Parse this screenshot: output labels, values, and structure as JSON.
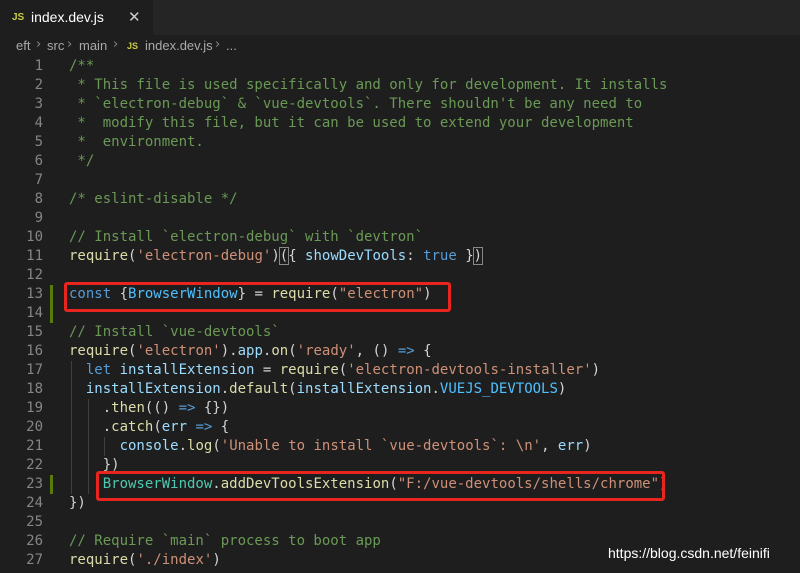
{
  "tab": {
    "badge": "JS",
    "title": "index.dev.js",
    "close_glyph": "✕"
  },
  "breadcrumb": {
    "items": [
      "eft",
      "src",
      "main"
    ],
    "file_badge": "JS",
    "file": "index.dev.js",
    "more": "..."
  },
  "editor": {
    "line_numbers": [
      "1",
      "2",
      "3",
      "4",
      "5",
      "6",
      "7",
      "8",
      "9",
      "10",
      "11",
      "12",
      "13",
      "14",
      "15",
      "16",
      "17",
      "18",
      "19",
      "20",
      "21",
      "22",
      "23",
      "24",
      "25",
      "26",
      "27"
    ],
    "lines": [
      [
        {
          "t": "/**",
          "c": "c"
        }
      ],
      [
        {
          "t": " * This file is used specifically and only for development. It installs",
          "c": "c"
        }
      ],
      [
        {
          "t": " * `electron-debug` & `vue-devtools`. There shouldn't be any need to",
          "c": "c"
        }
      ],
      [
        {
          "t": " *  modify this file, but it can be used to extend your development",
          "c": "c"
        }
      ],
      [
        {
          "t": " *  environment.",
          "c": "c"
        }
      ],
      [
        {
          "t": " */",
          "c": "c"
        }
      ],
      [],
      [
        {
          "t": "/* eslint-disable */",
          "c": "c"
        }
      ],
      [],
      [
        {
          "t": "// Install `electron-debug` with `devtron`",
          "c": "c"
        }
      ],
      [
        {
          "t": "require",
          "c": "f"
        },
        {
          "t": "(",
          "c": "p"
        },
        {
          "t": "'electron-debug'",
          "c": "s"
        },
        {
          "t": ")",
          "c": "p"
        },
        {
          "t": "(",
          "c": "p bracket"
        },
        {
          "t": "{ ",
          "c": "p"
        },
        {
          "t": "showDevTools",
          "c": "v"
        },
        {
          "t": ": ",
          "c": "p"
        },
        {
          "t": "true",
          "c": "k"
        },
        {
          "t": " }",
          "c": "p"
        },
        {
          "t": ")",
          "c": "p bracket"
        }
      ],
      [],
      [
        {
          "t": "const",
          "c": "k"
        },
        {
          "t": " {",
          "c": "p"
        },
        {
          "t": "BrowserWindow",
          "c": "cst"
        },
        {
          "t": "} = ",
          "c": "p"
        },
        {
          "t": "require",
          "c": "f"
        },
        {
          "t": "(",
          "c": "p"
        },
        {
          "t": "\"electron\"",
          "c": "s"
        },
        {
          "t": ")",
          "c": "p"
        }
      ],
      [],
      [
        {
          "t": "// Install `vue-devtools`",
          "c": "c"
        }
      ],
      [
        {
          "t": "require",
          "c": "f"
        },
        {
          "t": "(",
          "c": "p"
        },
        {
          "t": "'electron'",
          "c": "s"
        },
        {
          "t": ").",
          "c": "p"
        },
        {
          "t": "app",
          "c": "v"
        },
        {
          "t": ".",
          "c": "p"
        },
        {
          "t": "on",
          "c": "f"
        },
        {
          "t": "(",
          "c": "p"
        },
        {
          "t": "'ready'",
          "c": "s"
        },
        {
          "t": ", () ",
          "c": "p"
        },
        {
          "t": "=>",
          "c": "k"
        },
        {
          "t": " {",
          "c": "p"
        }
      ],
      [
        {
          "t": "  ",
          "c": "p"
        },
        {
          "t": "let",
          "c": "k"
        },
        {
          "t": " ",
          "c": "p"
        },
        {
          "t": "installExtension",
          "c": "v"
        },
        {
          "t": " = ",
          "c": "p"
        },
        {
          "t": "require",
          "c": "f"
        },
        {
          "t": "(",
          "c": "p"
        },
        {
          "t": "'electron-devtools-installer'",
          "c": "s"
        },
        {
          "t": ")",
          "c": "p"
        }
      ],
      [
        {
          "t": "  ",
          "c": "p"
        },
        {
          "t": "installExtension",
          "c": "v"
        },
        {
          "t": ".",
          "c": "p"
        },
        {
          "t": "default",
          "c": "f"
        },
        {
          "t": "(",
          "c": "p"
        },
        {
          "t": "installExtension",
          "c": "v"
        },
        {
          "t": ".",
          "c": "p"
        },
        {
          "t": "VUEJS_DEVTOOLS",
          "c": "cst"
        },
        {
          "t": ")",
          "c": "p"
        }
      ],
      [
        {
          "t": "    .",
          "c": "p"
        },
        {
          "t": "then",
          "c": "f"
        },
        {
          "t": "(() ",
          "c": "p"
        },
        {
          "t": "=>",
          "c": "k"
        },
        {
          "t": " {})",
          "c": "p"
        }
      ],
      [
        {
          "t": "    .",
          "c": "p"
        },
        {
          "t": "catch",
          "c": "f"
        },
        {
          "t": "(",
          "c": "p"
        },
        {
          "t": "err",
          "c": "v"
        },
        {
          "t": " ",
          "c": "p"
        },
        {
          "t": "=>",
          "c": "k"
        },
        {
          "t": " {",
          "c": "p"
        }
      ],
      [
        {
          "t": "      ",
          "c": "p"
        },
        {
          "t": "console",
          "c": "v"
        },
        {
          "t": ".",
          "c": "p"
        },
        {
          "t": "log",
          "c": "f"
        },
        {
          "t": "(",
          "c": "p"
        },
        {
          "t": "'Unable to install `vue-devtools`: \\n'",
          "c": "s"
        },
        {
          "t": ", ",
          "c": "p"
        },
        {
          "t": "err",
          "c": "v"
        },
        {
          "t": ")",
          "c": "p"
        }
      ],
      [
        {
          "t": "    })",
          "c": "p"
        }
      ],
      [
        {
          "t": "    ",
          "c": "p"
        },
        {
          "t": "BrowserWindow",
          "c": "t"
        },
        {
          "t": ".",
          "c": "p"
        },
        {
          "t": "addDevToolsExtension",
          "c": "f"
        },
        {
          "t": "(",
          "c": "p"
        },
        {
          "t": "\"F:/vue-devtools/shells/chrome\"",
          "c": "s"
        },
        {
          "t": ")",
          "c": "p"
        }
      ],
      [
        {
          "t": "})",
          "c": "p"
        }
      ],
      [],
      [
        {
          "t": "// Require `main` process to boot app",
          "c": "c"
        }
      ],
      [
        {
          "t": "require",
          "c": "f"
        },
        {
          "t": "(",
          "c": "p"
        },
        {
          "t": "'./index'",
          "c": "s"
        },
        {
          "t": ")",
          "c": "p"
        }
      ]
    ],
    "modified_lines": [
      13,
      14,
      23
    ]
  },
  "watermark": "https://blog.csdn.net/feinifi",
  "colors": {
    "highlight_box": "#e8251f",
    "gutter_added": "#587c0c"
  }
}
